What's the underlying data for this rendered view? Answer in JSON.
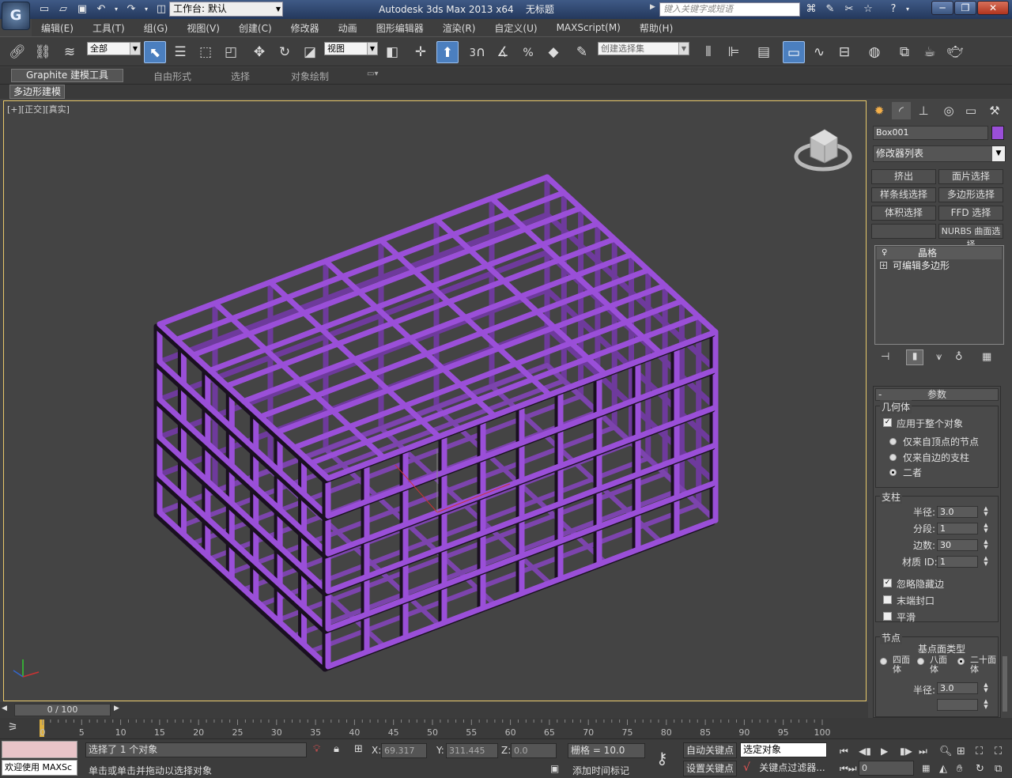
{
  "app": {
    "window_title": "Autodesk 3ds Max  2013 x64",
    "doc_title": "无标题",
    "app_icon_label": "G",
    "workspace_label": "工作台: 默认",
    "search_placeholder": "键入关键字或短语"
  },
  "menu": [
    "编辑(E)",
    "工具(T)",
    "组(G)",
    "视图(V)",
    "创建(C)",
    "修改器",
    "动画",
    "图形编辑器",
    "渲染(R)",
    "自定义(U)",
    "MAXScript(M)",
    "帮助(H)"
  ],
  "toolbar": {
    "filter_value": "全部",
    "refcoord_value": "视图",
    "selset_placeholder": "创建选择集",
    "snap_labels": [
      "3",
      "%"
    ]
  },
  "ribbon": {
    "tabs": [
      "Graphite 建模工具",
      "自由形式",
      "选择",
      "对象绘制"
    ],
    "subtab": "多边形建模"
  },
  "viewport": {
    "label": "[+][正交][真实]",
    "object_color": "#9a4fd8"
  },
  "command_panel": {
    "object_name": "Box001",
    "object_color": "#9a4fd8",
    "modifier_list": "修改器列表",
    "mod_buttons": [
      "挤出",
      "面片选择",
      "样条线选择",
      "多边形选择",
      "体积选择",
      "FFD 选择",
      "",
      "NURBS 曲面选择"
    ],
    "stack": [
      "晶格",
      "可编辑多边形"
    ],
    "params_title": "参数",
    "geometry": {
      "title": "几何体",
      "apply_all": "应用于整个对象",
      "opt1": "仅来自顶点的节点",
      "opt2": "仅来自边的支柱",
      "opt3": "二者"
    },
    "struts": {
      "title": "支柱",
      "radius_label": "半径:",
      "radius": "3.0",
      "segs_label": "分段:",
      "segs": "1",
      "sides_label": "边数:",
      "sides": "30",
      "matid_label": "材质 ID:",
      "matid": "1",
      "ignore_hidden": "忽略隐藏边",
      "end_caps": "末端封口",
      "smooth": "平滑"
    },
    "joints": {
      "title": "节点",
      "base_type": "基点面类型",
      "tetra": "四面体",
      "octa": "八面体",
      "icosa": "二十面体",
      "radius_label": "半径:",
      "radius": "3.0"
    }
  },
  "timeline": {
    "frame": "0 / 100",
    "ticks": [
      "0",
      "5",
      "10",
      "15",
      "20",
      "25",
      "30",
      "35",
      "40",
      "45",
      "50",
      "55",
      "60",
      "65",
      "70",
      "75",
      "80",
      "85",
      "90",
      "95",
      "100"
    ]
  },
  "status": {
    "welcome": "欢迎使用 MAXSc",
    "selected": "选择了 1 个对象",
    "prompt": "单击或单击并拖动以选择对象",
    "x_label": "X:",
    "x": "69.317",
    "y_label": "Y:",
    "y": "311.445",
    "z_label": "Z:",
    "z": "0.0",
    "grid": "栅格 = 10.0",
    "add_time_tag": "添加时间标记",
    "auto_key": "自动关键点",
    "set_key": "设置关键点",
    "key_mode": "选定对象",
    "key_filters": "关键点过滤器...",
    "frame_field": "0"
  }
}
